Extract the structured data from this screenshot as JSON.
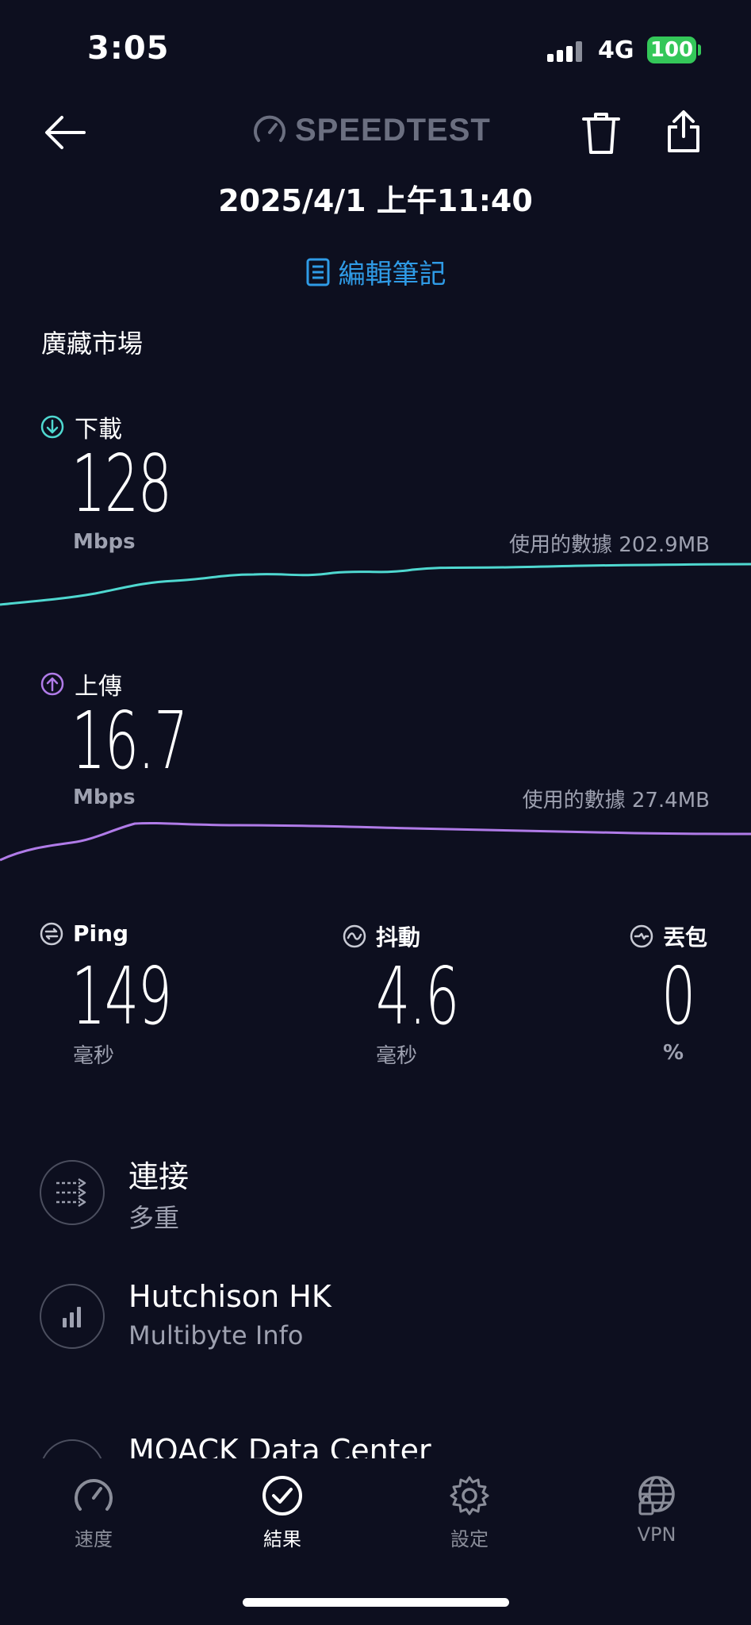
{
  "status_bar": {
    "time": "3:05",
    "network": "4G",
    "battery": "100"
  },
  "header": {
    "logo": "SPEEDTEST",
    "date": "2025/4/1 上午11:40",
    "edit_note": "編輯筆記",
    "location": "廣藏市場"
  },
  "download": {
    "label": "下載",
    "value": "128",
    "unit": "Mbps",
    "data_used": "使用的數據 202.9MB"
  },
  "upload": {
    "label": "上傳",
    "value": "16.7",
    "unit": "Mbps",
    "data_used": "使用的數據 27.4MB"
  },
  "ping": {
    "label": "Ping",
    "value": "149",
    "unit": "毫秒"
  },
  "jitter": {
    "label": "抖動",
    "value": "4.6",
    "unit": "毫秒"
  },
  "packet_loss": {
    "label": "丟包",
    "value": "0",
    "unit": "%"
  },
  "info_rows": [
    {
      "title": "連接",
      "subtitle": "多重",
      "icon": "connections-icon"
    },
    {
      "title": "Hutchison HK",
      "subtitle": "Multibyte Info",
      "icon": "provider-signal-icon"
    },
    {
      "title": "MOACK Data Center",
      "subtitle": "",
      "icon": "server-icon"
    }
  ],
  "nav": {
    "speed": "速度",
    "results": "結果",
    "settings": "設定",
    "vpn": "VPN"
  },
  "colors": {
    "background": "#0d0f1f",
    "download": "#4fd8d0",
    "upload": "#b07be8",
    "accent": "#2f9be6"
  }
}
